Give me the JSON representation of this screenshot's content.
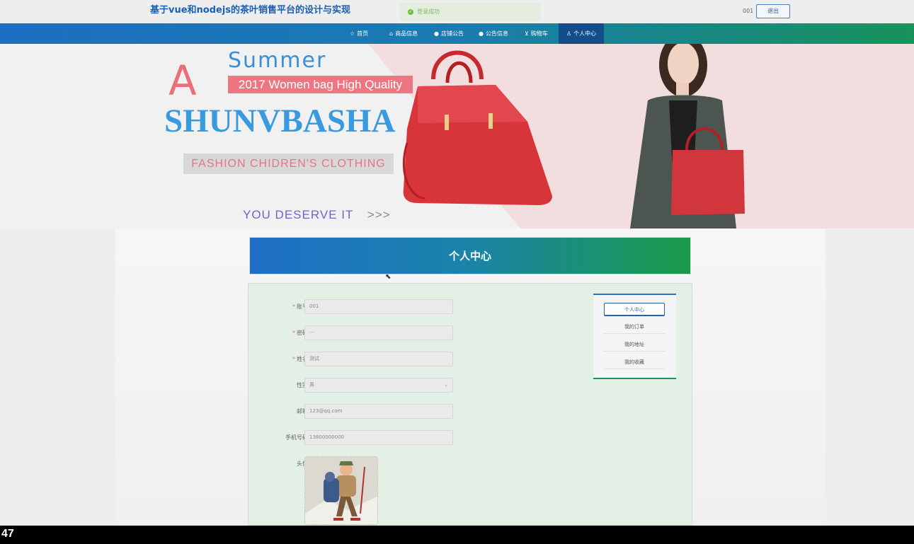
{
  "app": {
    "title": "基于vue和nodejs的茶叶销售平台的设计与实现"
  },
  "toast": {
    "message": "登录成功",
    "icon": "check-circle-icon"
  },
  "user": {
    "name": "001",
    "logout_label": "退出"
  },
  "nav": {
    "items": [
      {
        "label": "首页",
        "icon": "star-icon"
      },
      {
        "label": "商品信息",
        "icon": "home-icon"
      },
      {
        "label": "店铺公告",
        "icon": "info-icon"
      },
      {
        "label": "公告信息",
        "icon": "question-icon"
      },
      {
        "label": "购物车",
        "icon": "cart-icon"
      },
      {
        "label": "个人中心",
        "icon": "user-icon"
      }
    ],
    "active_index": 5
  },
  "banner": {
    "letter_a": "A",
    "summer": "Summer",
    "quality": "2017 Women bag High Quality",
    "brand": "SHUNVBASHA",
    "fashion": "FASHION CHIDREN'S CLOTHING",
    "deserve": "YOU DESERVE IT",
    "arrows": ">>>"
  },
  "section": {
    "title": "个人中心"
  },
  "form": {
    "fields": [
      {
        "label": "账号",
        "value": "001",
        "required": true
      },
      {
        "label": "密码",
        "value": "···",
        "required": true
      },
      {
        "label": "姓名",
        "value": "测试",
        "required": true
      },
      {
        "label": "性别",
        "value": "男",
        "required": false
      },
      {
        "label": "邮箱",
        "value": "123@qq.com",
        "required": false
      },
      {
        "label": "手机号码",
        "value": "13800000000",
        "required": false
      }
    ],
    "avatar_label": "头像",
    "required_mark": "*"
  },
  "side_menu": {
    "items": [
      {
        "label": "个人中心"
      },
      {
        "label": "我的订单"
      },
      {
        "label": "我的地址"
      },
      {
        "label": "我的收藏"
      }
    ],
    "active_index": 0
  },
  "colors": {
    "nav_start": "#1c6fc2",
    "nav_end": "#17935a",
    "title_text": "#1a5fb4",
    "success": "#67c23a"
  },
  "footer": {
    "page_number": "47"
  }
}
